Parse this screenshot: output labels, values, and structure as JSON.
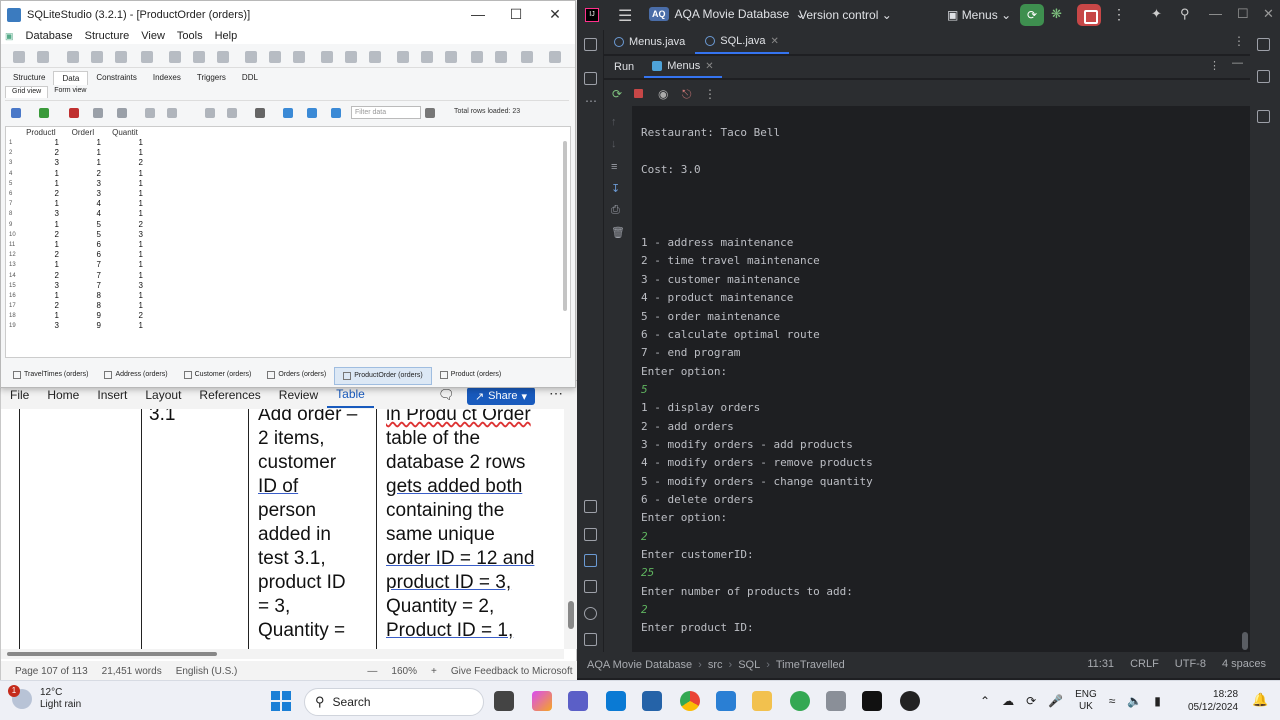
{
  "sqlite": {
    "title": "SQLiteStudio (3.2.1) - [ProductOrder (orders)]",
    "menu": [
      "Database",
      "Structure",
      "View",
      "Tools",
      "Help"
    ],
    "tabs": [
      "Structure",
      "Data",
      "Constraints",
      "Indexes",
      "Triggers",
      "DDL"
    ],
    "active_tab": "Data",
    "subtabs": [
      "Grid view",
      "Form view"
    ],
    "filter_placeholder": "Filter data",
    "rows_loaded": "Total rows loaded: 23",
    "columns": [
      "ProductI",
      "OrderI",
      "Quantit"
    ],
    "rows": [
      {
        "n": "1",
        "cells": [
          "1",
          "1",
          "1"
        ]
      },
      {
        "n": "2",
        "cells": [
          "2",
          "1",
          "1"
        ]
      },
      {
        "n": "3",
        "cells": [
          "3",
          "1",
          "2"
        ]
      },
      {
        "n": "4",
        "cells": [
          "1",
          "2",
          "1"
        ]
      },
      {
        "n": "5",
        "cells": [
          "1",
          "3",
          "1"
        ]
      },
      {
        "n": "6",
        "cells": [
          "2",
          "3",
          "1"
        ]
      },
      {
        "n": "7",
        "cells": [
          "1",
          "4",
          "1"
        ]
      },
      {
        "n": "8",
        "cells": [
          "3",
          "4",
          "1"
        ]
      },
      {
        "n": "9",
        "cells": [
          "1",
          "5",
          "2"
        ]
      },
      {
        "n": "10",
        "cells": [
          "2",
          "5",
          "3"
        ]
      },
      {
        "n": "11",
        "cells": [
          "1",
          "6",
          "1"
        ]
      },
      {
        "n": "12",
        "cells": [
          "2",
          "6",
          "1"
        ]
      },
      {
        "n": "13",
        "cells": [
          "1",
          "7",
          "1"
        ]
      },
      {
        "n": "14",
        "cells": [
          "2",
          "7",
          "1"
        ]
      },
      {
        "n": "15",
        "cells": [
          "3",
          "7",
          "3"
        ]
      },
      {
        "n": "16",
        "cells": [
          "1",
          "8",
          "1"
        ]
      },
      {
        "n": "17",
        "cells": [
          "2",
          "8",
          "1"
        ]
      },
      {
        "n": "18",
        "cells": [
          "1",
          "9",
          "2"
        ]
      },
      {
        "n": "19",
        "cells": [
          "3",
          "9",
          "1"
        ]
      }
    ],
    "doc_tabs": [
      "TravelTimes (orders)",
      "Address (orders)",
      "Customer (orders)",
      "Orders (orders)",
      "ProductOrder (orders)",
      "Product (orders)"
    ],
    "active_doc_tab": "ProductOrder (orders)"
  },
  "word": {
    "ribbon_tabs": [
      "File",
      "Home",
      "Insert",
      "Layout",
      "References",
      "Review",
      "Table"
    ],
    "active_ribbon": "Table",
    "share_label": "Share",
    "col_a": "3.1",
    "col_b_lines": [
      "Add order –",
      "2 items,",
      "customer",
      "ID  of",
      "person",
      "added in",
      "test 3.1,",
      "product ID",
      "= 3,",
      "Quantity ="
    ],
    "col_c_lines": [
      "in Produ ct Order",
      "table of the",
      "database 2 rows",
      "gets added both",
      "containing the",
      "same unique",
      "order ID = 12 and",
      "product ID = 3,",
      "Quantity = 2,",
      "Product ID  = 1,"
    ],
    "status_page": "Page 107 of 113",
    "status_words": "21,451 words",
    "status_lang": "English (U.S.)",
    "zoom": "160%",
    "feedback": "Give Feedback to Microsoft"
  },
  "intellij": {
    "project_badge": "AQ",
    "project": "AQA Movie Database",
    "version_control": "Version control",
    "run_config": "Menus",
    "editor_tabs": [
      "Menus.java",
      "SQL.java"
    ],
    "active_editor_tab": "SQL.java",
    "run_label": "Run",
    "run_tab": "Menus",
    "console": [
      {
        "text": "Restaurant: Taco Bell",
        "input": false
      },
      {
        "text": "",
        "input": false
      },
      {
        "text": "Cost: 3.0",
        "input": false
      },
      {
        "text": "",
        "input": false
      },
      {
        "text": "",
        "input": false
      },
      {
        "text": "",
        "input": false
      },
      {
        "text": "1 - address maintenance",
        "input": false
      },
      {
        "text": "2 - time travel maintenance",
        "input": false
      },
      {
        "text": "3 - customer maintenance",
        "input": false
      },
      {
        "text": "4 - product maintenance",
        "input": false
      },
      {
        "text": "5 - order maintenance",
        "input": false
      },
      {
        "text": "6 - calculate optimal route",
        "input": false
      },
      {
        "text": "7 - end program",
        "input": false
      },
      {
        "text": "Enter option:",
        "input": false
      },
      {
        "text": "5",
        "input": true
      },
      {
        "text": "1 - display orders",
        "input": false
      },
      {
        "text": "2 - add orders",
        "input": false
      },
      {
        "text": "3 - modify orders - add products",
        "input": false
      },
      {
        "text": "4 - modify orders - remove products",
        "input": false
      },
      {
        "text": "5 - modify orders - change quantity",
        "input": false
      },
      {
        "text": "6 - delete orders",
        "input": false
      },
      {
        "text": "Enter option:",
        "input": false
      },
      {
        "text": "2",
        "input": true
      },
      {
        "text": "Enter customerID:",
        "input": false
      },
      {
        "text": "25",
        "input": true
      },
      {
        "text": "Enter number of products to add:",
        "input": false
      },
      {
        "text": "2",
        "input": true
      },
      {
        "text": "Enter product ID:",
        "input": false
      }
    ],
    "breadcrumb": [
      "AQA Movie Database",
      "src",
      "SQL",
      "TimeTravelled"
    ],
    "status_right": [
      "11:31",
      "CRLF",
      "UTF-8",
      "4 spaces"
    ]
  },
  "taskbar": {
    "notif_count": "1",
    "temp": "12°C",
    "weather": "Light rain",
    "search_label": "Search",
    "lang_top": "ENG",
    "lang_bottom": "UK",
    "time": "18:28",
    "date": "05/12/2024"
  }
}
